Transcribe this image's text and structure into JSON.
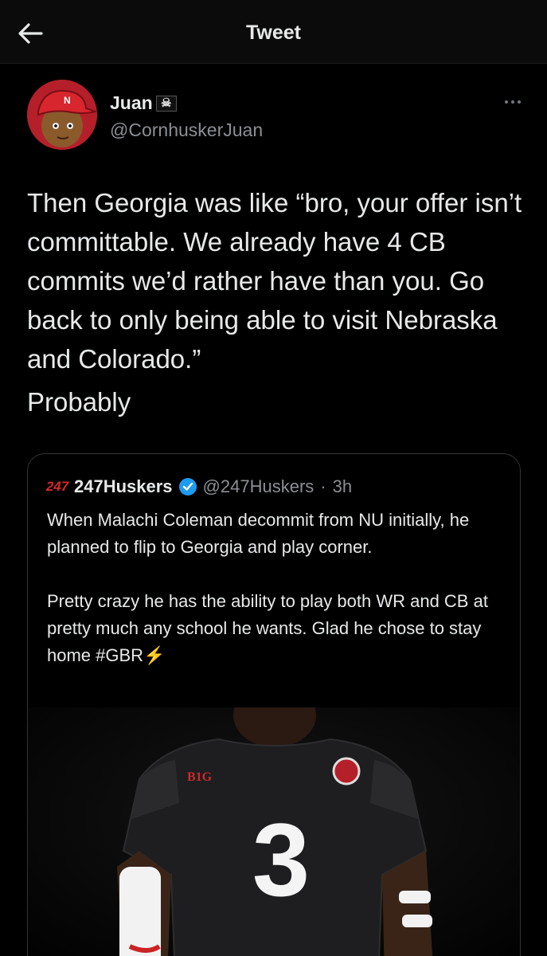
{
  "header": {
    "title": "Tweet",
    "back_icon": "arrow-left-icon"
  },
  "author": {
    "name": "Juan",
    "flag_icon": "pirate-flag-icon",
    "flag_glyph": "☠",
    "handle": "@CornhuskerJuan",
    "avatar_color": "#b51f2a"
  },
  "tweet": {
    "text": "Then Georgia was like “bro, your offer isn’t committable. We already have 4 CB commits we’d rather have than you. Go back to only being able to visit Nebraska and Colorado.”",
    "text2": "Probably"
  },
  "quote": {
    "logo": "247",
    "name": "247Huskers",
    "handle": "@247Huskers",
    "separator": "·",
    "time": "3h",
    "text": "When Malachi Coleman decommit from NU initially, he planned to flip to Georgia and play corner.\n\nPretty crazy he has the ability to play both WR and CB at pretty much any school he wants. Glad he chose to stay home #GBR⚡",
    "image": {
      "jersey_number": "3",
      "jersey_patch": "B1G",
      "jersey_color": "#1e1e20"
    }
  },
  "colors": {
    "background": "#000000",
    "text": "#e7e9ea",
    "secondary_text": "#8b8f94",
    "verified": "#1d9bf0",
    "brand_red": "#d62828"
  }
}
